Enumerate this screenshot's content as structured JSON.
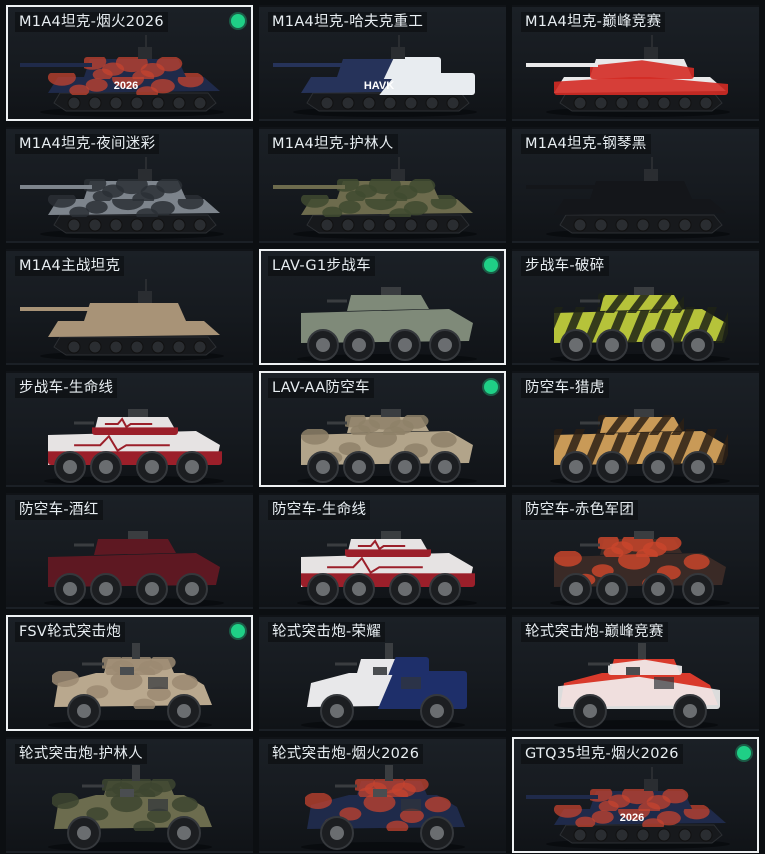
{
  "colors": {
    "selected_border": "#eef1f3",
    "badge": "#1fcf86"
  },
  "cards": [
    {
      "name": "M1A4坦克-烟火2026",
      "type": "tank",
      "selected": true,
      "badge": true,
      "body": "#1f2a4a",
      "accent": "#c4432f",
      "pattern": "firework",
      "decal": "2026"
    },
    {
      "name": "M1A4坦克-哈夫克重工",
      "type": "tank",
      "selected": false,
      "badge": false,
      "body": "#26335a",
      "accent": "#e8ecf0",
      "pattern": "split",
      "decal": "HAVK"
    },
    {
      "name": "M1A4坦克-巅峰竞赛",
      "type": "tank",
      "selected": false,
      "badge": false,
      "body": "#e9e9ea",
      "accent": "#d42b25",
      "pattern": "race",
      "decal": ""
    },
    {
      "name": "M1A4坦克-夜间迷彩",
      "type": "tank",
      "selected": false,
      "badge": false,
      "body": "#7d848c",
      "accent": "#2a2f35",
      "pattern": "camo",
      "decal": ""
    },
    {
      "name": "M1A4坦克-护林人",
      "type": "tank",
      "selected": false,
      "badge": false,
      "body": "#6d6b4d",
      "accent": "#3f4a30",
      "pattern": "camo",
      "decal": ""
    },
    {
      "name": "M1A4坦克-钢琴黑",
      "type": "tank",
      "selected": false,
      "badge": false,
      "body": "#14161a",
      "accent": "#2e3238",
      "pattern": "plain",
      "decal": ""
    },
    {
      "name": "M1A4主战坦克",
      "type": "tank",
      "selected": false,
      "badge": false,
      "body": "#a89377",
      "accent": "#8a7760",
      "pattern": "plain",
      "decal": ""
    },
    {
      "name": "LAV-G1步战车",
      "type": "apc",
      "selected": true,
      "badge": true,
      "body": "#7f8a79",
      "accent": "#667161",
      "pattern": "plain",
      "decal": ""
    },
    {
      "name": "步战车-破碎",
      "type": "apc",
      "selected": false,
      "badge": false,
      "body": "#b6c33a",
      "accent": "#1e2316",
      "pattern": "stripes",
      "decal": ""
    },
    {
      "name": "步战车-生命线",
      "type": "apc",
      "selected": false,
      "badge": false,
      "body": "#e6e3e3",
      "accent": "#9b1f2a",
      "pattern": "lifeline",
      "decal": ""
    },
    {
      "name": "LAV-AA防空车",
      "type": "apc",
      "selected": true,
      "badge": true,
      "body": "#b2a48a",
      "accent": "#8e8169",
      "pattern": "camo",
      "decal": ""
    },
    {
      "name": "防空车-猎虎",
      "type": "apc",
      "selected": false,
      "badge": false,
      "body": "#c99a57",
      "accent": "#2c2015",
      "pattern": "stripes",
      "decal": ""
    },
    {
      "name": "防空车-酒红",
      "type": "apc",
      "selected": false,
      "badge": false,
      "body": "#5e1822",
      "accent": "#3b0f16",
      "pattern": "plain",
      "decal": ""
    },
    {
      "name": "防空车-生命线",
      "type": "apc",
      "selected": false,
      "badge": false,
      "body": "#e6e3e3",
      "accent": "#9b1f2a",
      "pattern": "lifeline",
      "decal": ""
    },
    {
      "name": "防空车-赤色军团",
      "type": "apc",
      "selected": false,
      "badge": false,
      "body": "#3a2a26",
      "accent": "#c8452b",
      "pattern": "camo",
      "decal": ""
    },
    {
      "name": "FSV轮式突击炮",
      "type": "fsv",
      "selected": true,
      "badge": true,
      "body": "#b9a88e",
      "accent": "#9b8a72",
      "pattern": "camo",
      "decal": ""
    },
    {
      "name": "轮式突击炮-荣耀",
      "type": "fsv",
      "selected": false,
      "badge": false,
      "body": "#e8e8ea",
      "accent": "#1e2f6a",
      "pattern": "split",
      "decal": ""
    },
    {
      "name": "轮式突击炮-巅峰竞赛",
      "type": "fsv",
      "selected": false,
      "badge": false,
      "body": "#d93a2c",
      "accent": "#f2f2f2",
      "pattern": "race",
      "decal": ""
    },
    {
      "name": "轮式突击炮-护林人",
      "type": "fsv",
      "selected": false,
      "badge": false,
      "body": "#6c6c4e",
      "accent": "#3d4530",
      "pattern": "camo",
      "decal": ""
    },
    {
      "name": "轮式突击炮-烟火2026",
      "type": "fsv",
      "selected": false,
      "badge": false,
      "body": "#1f2a4a",
      "accent": "#c4432f",
      "pattern": "firework",
      "decal": ""
    },
    {
      "name": "GTQ35坦克-烟火2026",
      "type": "tank",
      "selected": true,
      "badge": true,
      "body": "#1f2a4a",
      "accent": "#c4432f",
      "pattern": "firework",
      "decal": "2026"
    }
  ]
}
